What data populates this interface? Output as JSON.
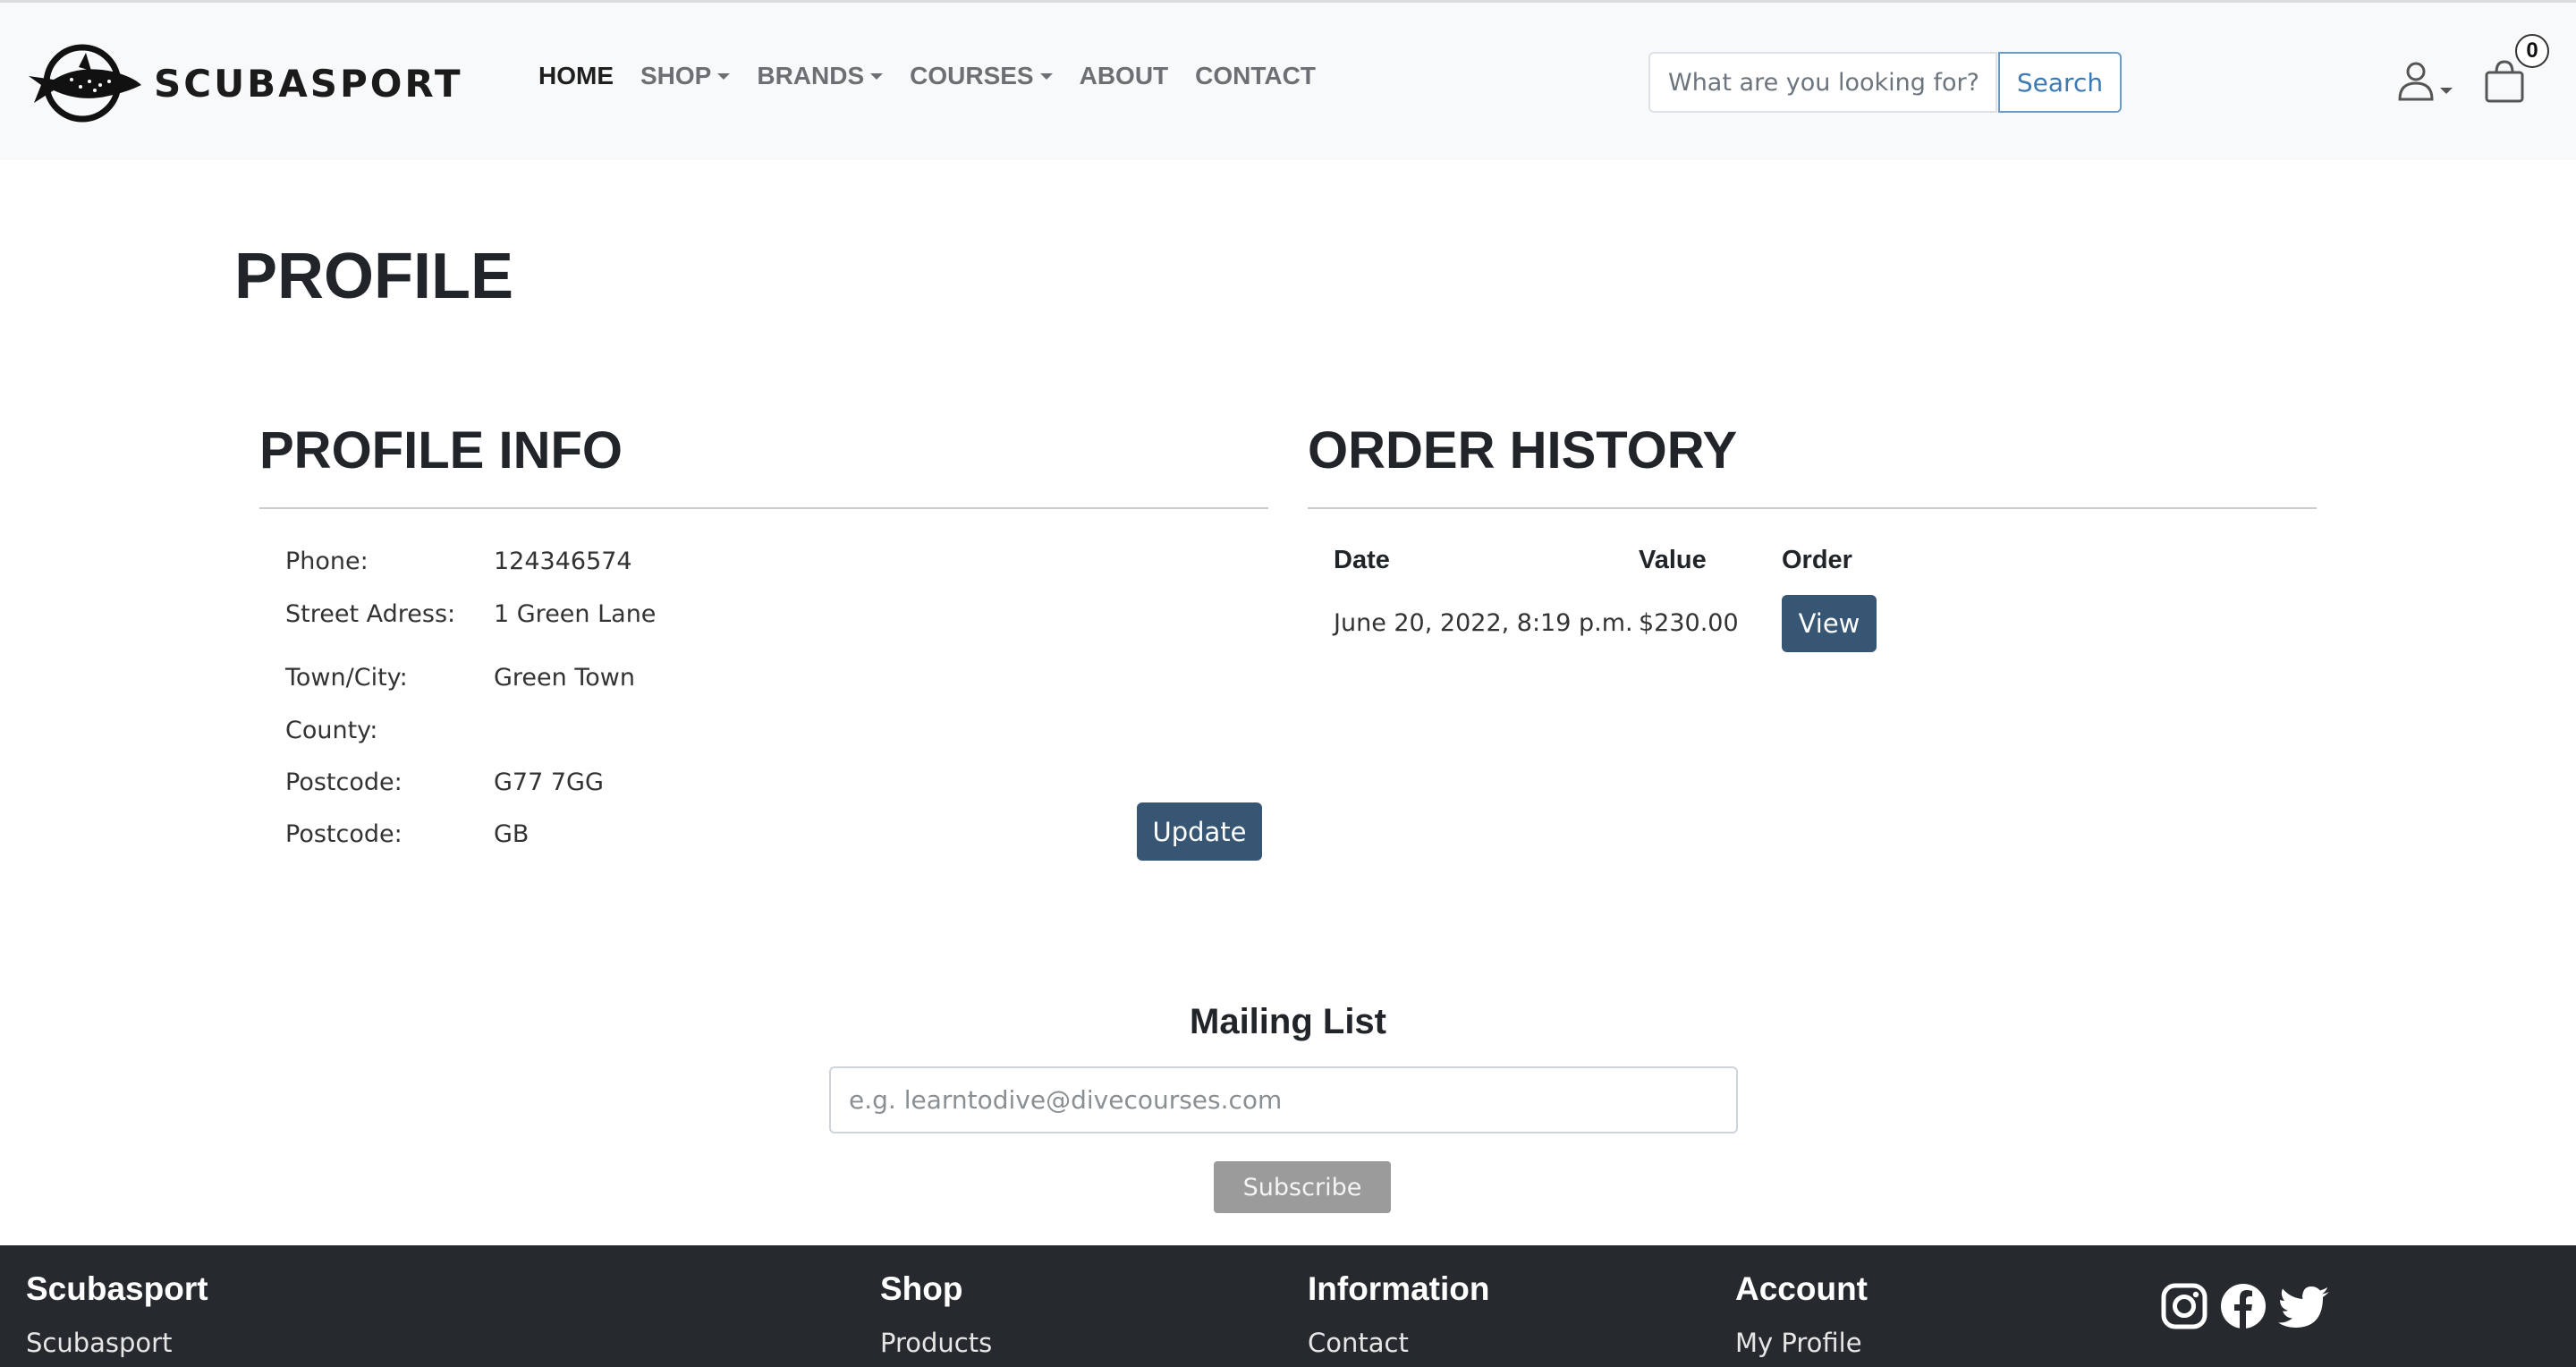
{
  "brand": {
    "name": "SCUBASPORT"
  },
  "nav": {
    "items": [
      {
        "label": "HOME",
        "dropdown": false,
        "active": true
      },
      {
        "label": "SHOP",
        "dropdown": true
      },
      {
        "label": "BRANDS",
        "dropdown": true
      },
      {
        "label": "COURSES",
        "dropdown": true
      },
      {
        "label": "ABOUT",
        "dropdown": false
      },
      {
        "label": "CONTACT",
        "dropdown": false
      }
    ]
  },
  "search": {
    "placeholder": "What are you looking for?",
    "button_label": "Search"
  },
  "cart": {
    "count": "0"
  },
  "page": {
    "title": "PROFILE"
  },
  "profile_info": {
    "title": "PROFILE INFO",
    "fields": [
      {
        "label": "Phone:",
        "value": "124346574"
      },
      {
        "label": "Street Adress:",
        "value": "1 Green Lane"
      },
      {
        "label": "Town/City:",
        "value": "Green Town"
      },
      {
        "label": "County:",
        "value": ""
      },
      {
        "label": "Postcode:",
        "value": "G77 7GG"
      },
      {
        "label": "Postcode:",
        "value": "GB"
      }
    ],
    "update_label": "Update"
  },
  "order_history": {
    "title": "ORDER HISTORY",
    "columns": [
      "Date",
      "Value",
      "Order"
    ],
    "rows": [
      {
        "date": "June 20, 2022, 8:19 p.m.",
        "value": "$230.00",
        "action": "View"
      }
    ]
  },
  "mailing": {
    "title": "Mailing List",
    "placeholder": "e.g. learntodive@divecourses.com",
    "button_label": "Subscribe"
  },
  "footer": {
    "columns": [
      {
        "heading": "Scubasport",
        "link": "Scubasport"
      },
      {
        "heading": "Shop",
        "link": "Products"
      },
      {
        "heading": "Information",
        "link": "Contact"
      },
      {
        "heading": "Account",
        "link": "My Profile"
      }
    ],
    "social": [
      "instagram-icon",
      "facebook-icon",
      "twitter-icon"
    ]
  },
  "colors": {
    "header_bg": "#f8f9fa",
    "primary_button": "#365674",
    "search_accent": "#3d7ab3",
    "footer_bg": "#262a2e",
    "subscribe_bg": "#9b9b9b"
  }
}
